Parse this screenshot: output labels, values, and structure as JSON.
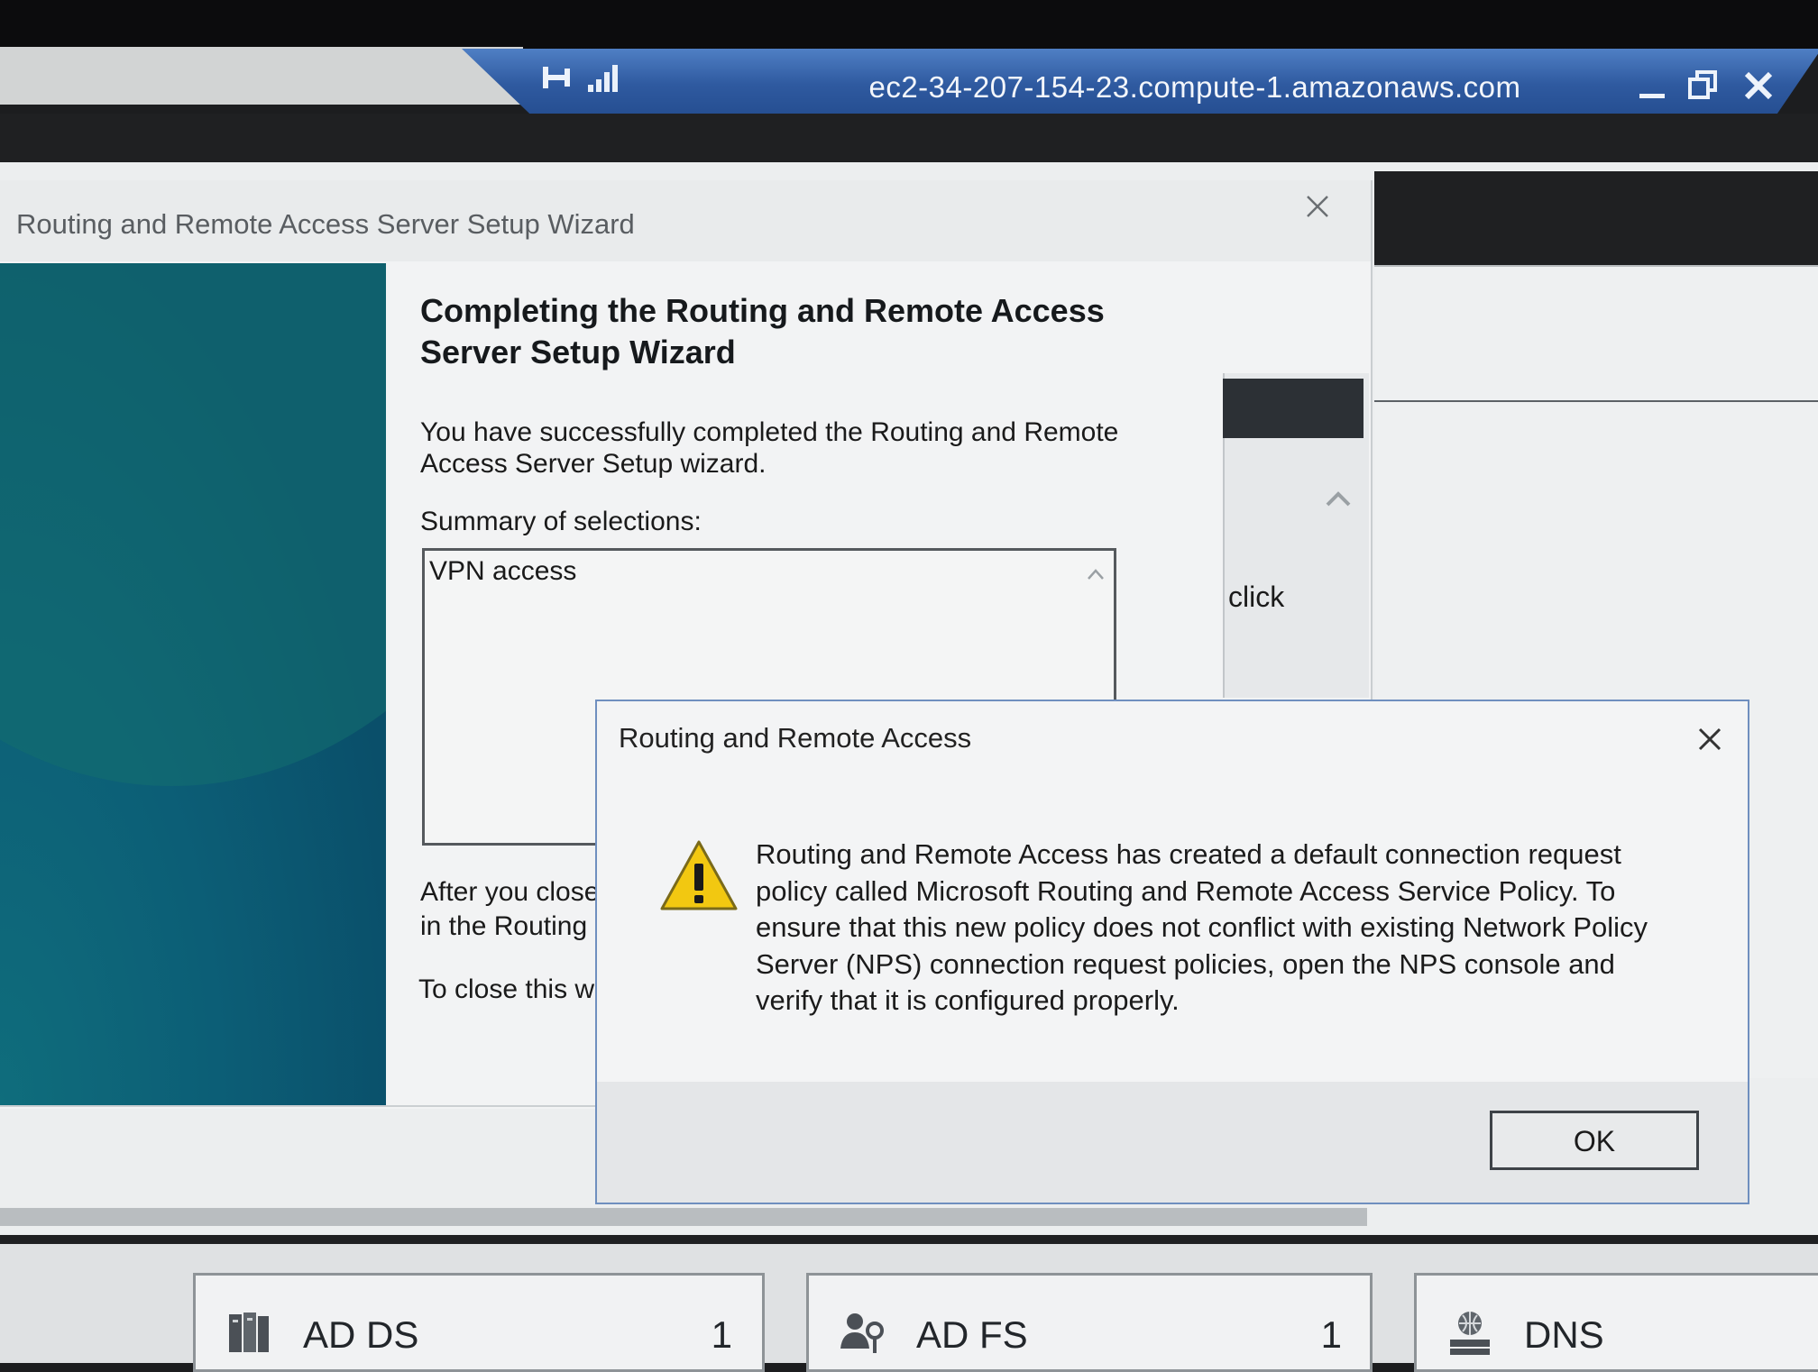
{
  "rdp_bar": {
    "host": "ec2-34-207-154-23.compute-1.amazonaws.com",
    "pin_icon": "pin-icon",
    "signal_icon": "connection-signal-icon",
    "controls": {
      "minimize": "minimize-icon",
      "restore": "restore-icon",
      "close": "close-icon"
    }
  },
  "wizard": {
    "title": "Routing and Remote Access Server Setup Wizard",
    "heading": "Completing the Routing and Remote Access Server Setup Wizard",
    "success_text": "You have successfully completed the Routing and Remote Access Server Setup wizard.",
    "summary_label": "Summary of selections:",
    "summary_items": [
      "VPN access"
    ],
    "after_text_line1": "After you close",
    "after_text_line2": "in the Routing",
    "close_text": "To close this wi"
  },
  "background_window": {
    "partial_text": "click"
  },
  "alert": {
    "title": "Routing and Remote Access",
    "message": "Routing and Remote Access has created a default connection request policy called Microsoft Routing and Remote Access Service Policy. To ensure that this new policy does not conflict with existing Network Policy Server (NPS) connection request policies, open the NPS console and verify that it is configured properly.",
    "icon": "warning-icon",
    "ok_label": "OK"
  },
  "dashboard_tiles": [
    {
      "label": "AD DS",
      "count": "1",
      "icon": "ad-ds-icon"
    },
    {
      "label": "AD FS",
      "count": "1",
      "icon": "ad-fs-icon"
    },
    {
      "label": "DNS",
      "icon": "dns-icon"
    }
  ],
  "colors": {
    "rdp_bar": "#2f5aa0",
    "wizard_banner": "#0c5e76",
    "alert_border": "#6f8fbf",
    "warning_yellow": "#f2c811"
  }
}
